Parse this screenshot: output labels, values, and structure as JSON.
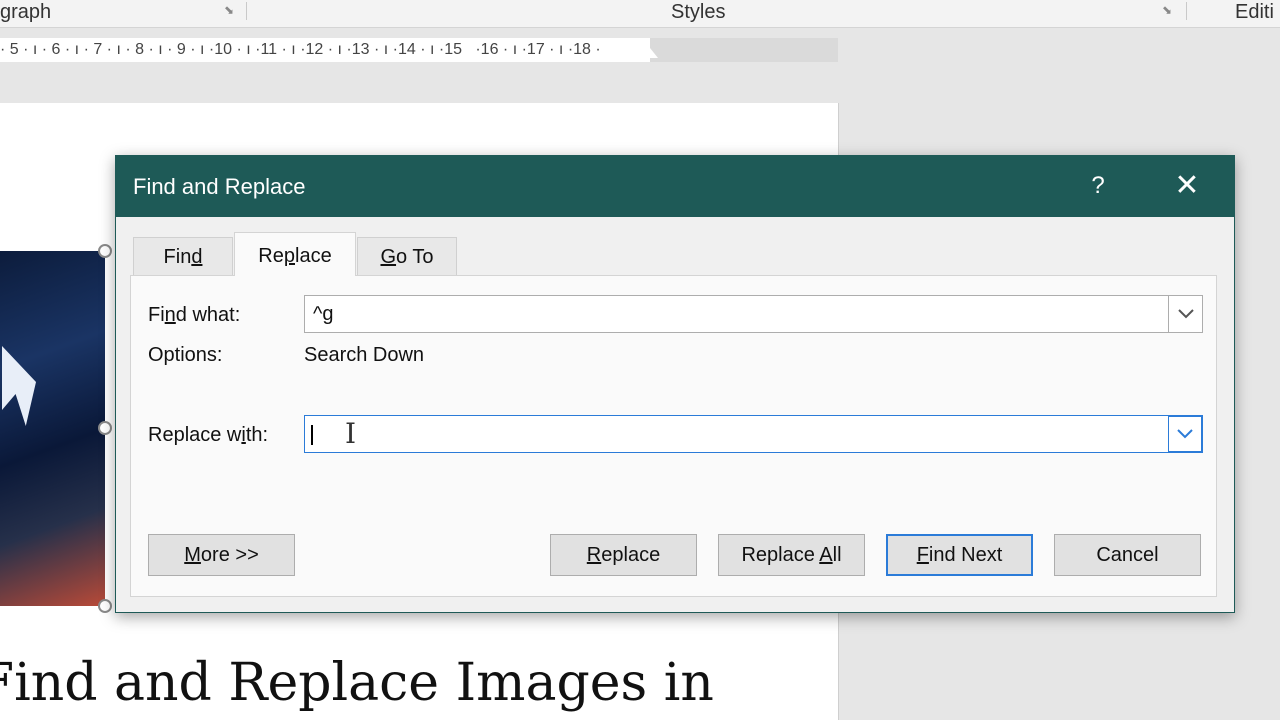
{
  "ribbon": {
    "paragraph_label": "graph",
    "styles_label": "Styles",
    "editing_label": "Editi",
    "launcher_icon": "dialog-launcher-icon"
  },
  "ruler": {
    "marks": "· 5 · ı · 6 · ı · 7 · ı · 8 · ı · 9 · ı ·10 · ı ·11 · ı ·12 · ı ·13 · ı ·14 · ı ·15   ·16 · ı ·17 · ı ·18 ·"
  },
  "document": {
    "heading": "Find and Replace Images in"
  },
  "dialog": {
    "title": "Find and Replace",
    "help_label": "?",
    "close_label": "✕",
    "tabs": [
      {
        "pre": "Fin",
        "key": "d",
        "post": "",
        "active": false
      },
      {
        "pre": "Re",
        "key": "p",
        "post": "lace",
        "active": true
      },
      {
        "pre": "",
        "key": "G",
        "post": "o To",
        "active": false
      }
    ],
    "find_what": {
      "pre": "Fi",
      "key": "n",
      "post": "d what:",
      "value": "^g"
    },
    "options": {
      "label": "Options:",
      "value": "Search Down"
    },
    "replace_with": {
      "pre": "Replace w",
      "key": "i",
      "post": "th:",
      "value": ""
    },
    "buttons": {
      "more": {
        "pre": "",
        "key": "M",
        "post": "ore >>"
      },
      "replace": {
        "pre": "",
        "key": "R",
        "post": "eplace"
      },
      "replace_all": {
        "pre": "Replace ",
        "key": "A",
        "post": "ll"
      },
      "find_next": {
        "pre": "",
        "key": "F",
        "post": "ind Next"
      },
      "cancel": "Cancel"
    }
  },
  "colors": {
    "titlebar": "#1e5a57",
    "focus": "#2b7bd8"
  }
}
